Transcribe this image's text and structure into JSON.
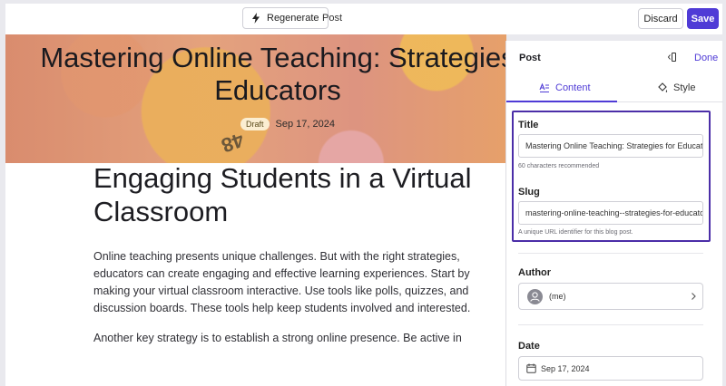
{
  "toolbar": {
    "regenerate_label": "Regenerate",
    "post_label": "Post",
    "discard_label": "Discard",
    "save_label": "Save"
  },
  "hero": {
    "title_line1": "Mastering Online Teaching: Strategies",
    "title_line2": "Educators",
    "badge": "Draft",
    "date": "Sep 17, 2024",
    "ball_number": "48"
  },
  "article": {
    "heading": "Engaging Students in a Virtual Classroom",
    "paragraphs": [
      "Online teaching presents unique challenges. But with the right strategies, educators can create engaging and effective learning experiences. Start by making your virtual classroom interactive. Use tools like polls, quizzes, and discussion boards. These tools help keep students involved and interested.",
      "Another key strategy is to establish a strong online presence. Be active in"
    ]
  },
  "panel": {
    "title": "Post",
    "done_label": "Done",
    "tabs": [
      {
        "label": "Content",
        "icon": "content-icon",
        "active": true
      },
      {
        "label": "Style",
        "icon": "paint-bucket-icon",
        "active": false
      }
    ],
    "title_field": {
      "label": "Title",
      "value": "Mastering Online Teaching: Strategies for Educators",
      "hint": "60 characters recommended"
    },
    "slug_field": {
      "label": "Slug",
      "value": "mastering-online-teaching--strategies-for-educators",
      "hint": "A unique URL identifier for this blog post."
    },
    "author": {
      "label": "Author",
      "name": "(me)"
    },
    "date": {
      "label": "Date",
      "value": "Sep 17, 2024"
    }
  },
  "colors": {
    "accent": "#4f3bd6",
    "highlight_border": "#4b2ea8",
    "badge_bg": "#fbeed2"
  }
}
